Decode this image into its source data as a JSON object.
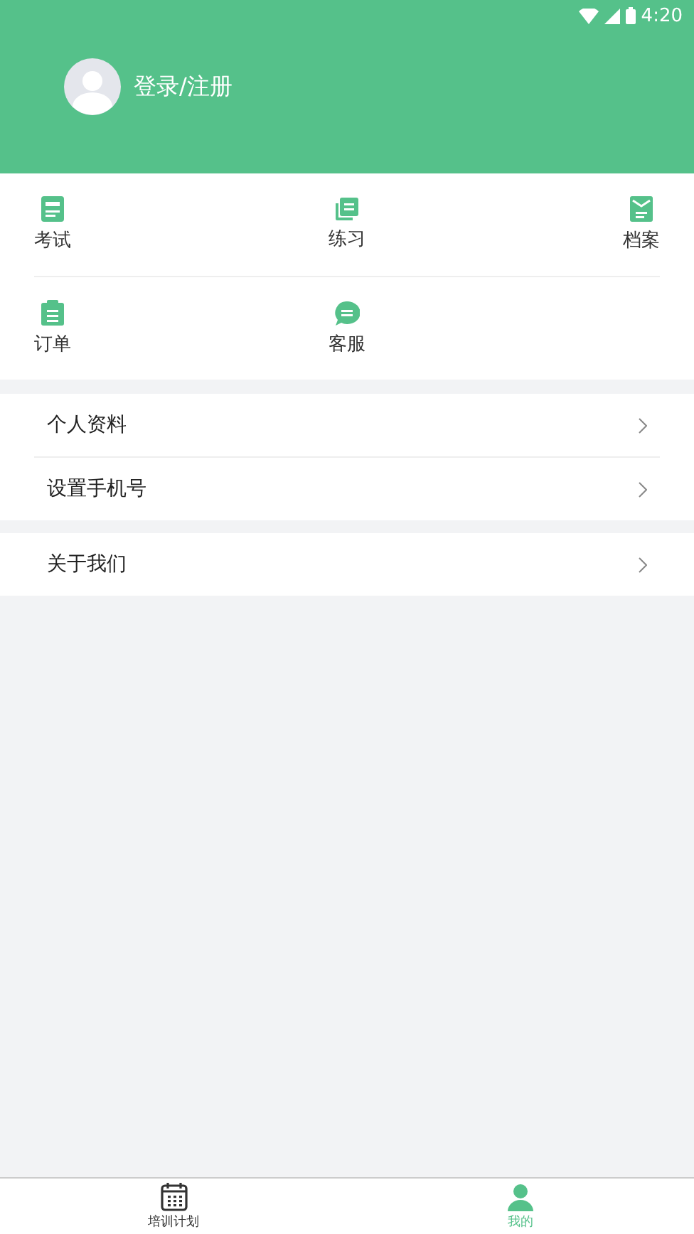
{
  "status_bar": {
    "time": "4:20"
  },
  "header": {
    "login": "登录/注册"
  },
  "shortcuts": [
    {
      "label": "考试"
    },
    {
      "label": "练习"
    },
    {
      "label": "档案"
    },
    {
      "label": "订单"
    },
    {
      "label": "客服"
    }
  ],
  "menu_groups": [
    [
      {
        "label": "个人资料"
      },
      {
        "label": "设置手机号"
      }
    ],
    [
      {
        "label": "关于我们"
      }
    ]
  ],
  "tab_bar": [
    {
      "label": "培训计划",
      "selected": false
    },
    {
      "label": "我的",
      "selected": true
    }
  ]
}
